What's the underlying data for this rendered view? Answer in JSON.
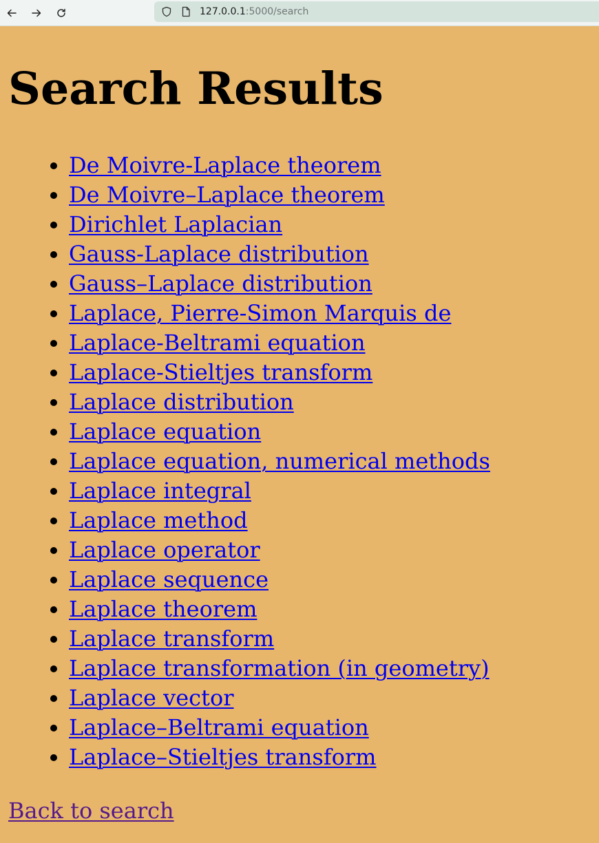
{
  "browser": {
    "url_host": "127.0.0.1",
    "url_rest": ":5000/search"
  },
  "page": {
    "title": "Search Results",
    "back_label": "Back to search"
  },
  "results": [
    "De Moivre-Laplace theorem",
    "De Moivre–Laplace theorem",
    "Dirichlet Laplacian",
    "Gauss-Laplace distribution",
    "Gauss–Laplace distribution",
    "Laplace, Pierre-Simon Marquis de",
    "Laplace-Beltrami equation",
    "Laplace-Stieltjes transform",
    "Laplace distribution",
    "Laplace equation",
    "Laplace equation, numerical methods",
    "Laplace integral",
    "Laplace method",
    "Laplace operator",
    "Laplace sequence",
    "Laplace theorem",
    "Laplace transform",
    "Laplace transformation (in geometry)",
    "Laplace vector",
    "Laplace–Beltrami equation",
    "Laplace–Stieltjes transform"
  ],
  "colors": {
    "background": "#e8b66a",
    "link": "#0000ee",
    "visited_link": "#551a8b"
  }
}
